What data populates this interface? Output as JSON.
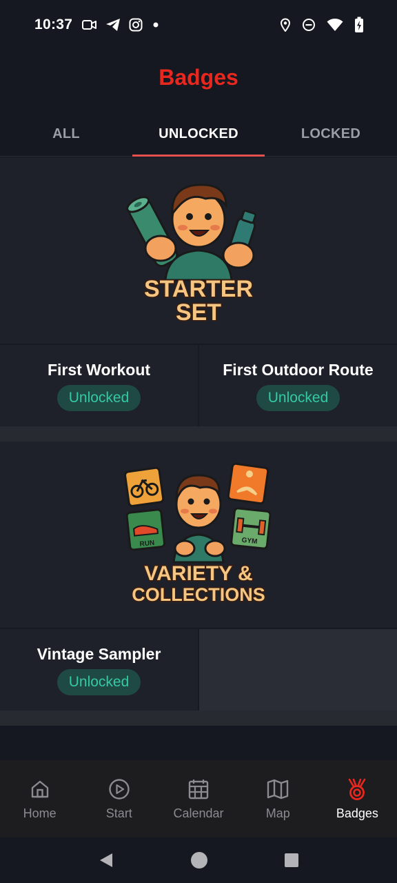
{
  "status_bar": {
    "time": "10:37",
    "left_icons": [
      "video-camera-icon",
      "telegram-icon",
      "instagram-icon",
      "dot-icon"
    ],
    "right_icons": [
      "location-icon",
      "do-not-disturb-icon",
      "wifi-icon",
      "battery-charging-icon"
    ]
  },
  "header": {
    "title": "Badges"
  },
  "tabs": [
    {
      "label": "ALL",
      "active": false
    },
    {
      "label": "UNLOCKED",
      "active": true
    },
    {
      "label": "LOCKED",
      "active": false
    }
  ],
  "sections": [
    {
      "logo_text": [
        "STARTER",
        "SET"
      ],
      "badges": [
        {
          "name": "First Workout",
          "status": "Unlocked"
        },
        {
          "name": "First Outdoor Route",
          "status": "Unlocked"
        }
      ]
    },
    {
      "logo_text": [
        "VARIETY &",
        "COLLECTIONS"
      ],
      "logo_labels": [
        "RUN",
        "GYM"
      ],
      "badges": [
        {
          "name": "Vintage Sampler",
          "status": "Unlocked"
        }
      ]
    }
  ],
  "bottom_nav": [
    {
      "label": "Home",
      "icon": "home-icon",
      "active": false
    },
    {
      "label": "Start",
      "icon": "play-circle-icon",
      "active": false
    },
    {
      "label": "Calendar",
      "icon": "calendar-icon",
      "active": false
    },
    {
      "label": "Map",
      "icon": "map-icon",
      "active": false
    },
    {
      "label": "Badges",
      "icon": "medal-icon",
      "active": true
    }
  ],
  "colors": {
    "accent": "#e8281e",
    "background": "#151820",
    "card": "#1e2129",
    "pill_bg": "#1f4a44",
    "pill_text": "#35c9a3",
    "tab_indicator": "#e85050"
  }
}
